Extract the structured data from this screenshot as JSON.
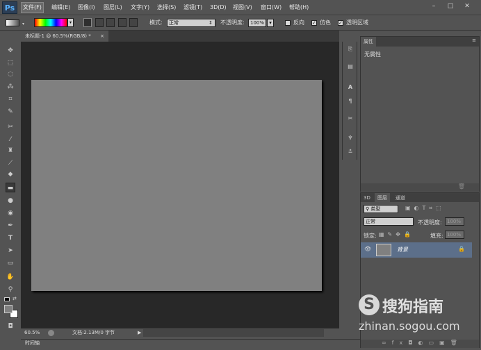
{
  "app": {
    "logo": "Ps"
  },
  "menubar": {
    "items": [
      "文件(F)",
      "编辑(E)",
      "图像(I)",
      "图层(L)",
      "文字(Y)",
      "选择(S)",
      "滤镜(T)",
      "3D(D)",
      "视图(V)",
      "窗口(W)",
      "帮助(H)"
    ],
    "active_index": 0
  },
  "window_controls": {
    "minimize": "–",
    "restore": "□",
    "close": "✕"
  },
  "options_bar": {
    "mode_label": "模式:",
    "mode_value": "正常",
    "opacity_label": "不透明度:",
    "opacity_value": "100%",
    "reverse_label": "反向",
    "dither_label": "仿色",
    "transparency_label": "透明区域",
    "dither_checked": true,
    "transparency_checked": true,
    "reverse_checked": false
  },
  "document": {
    "tab_title": "未标题-1 @ 60.5%(RGB/8) *",
    "close_glyph": "×",
    "canvas_color": "#808080"
  },
  "status_bar": {
    "zoom": "60.5%",
    "doc_info": "文档:2.13M/0 字节",
    "arrow": "▶"
  },
  "timeline": {
    "label": "时间轴"
  },
  "properties_panel": {
    "tab_label": "属性",
    "content": "无属性"
  },
  "layers_panel": {
    "tabs": [
      "3D",
      "图层",
      "通道"
    ],
    "active_tab_index": 1,
    "filter_label": "类型",
    "blend_mode": "正常",
    "opacity_label": "不透明度:",
    "opacity_value": "100%",
    "lock_label": "锁定:",
    "fill_label": "填充:",
    "fill_value": "100%",
    "layers": [
      {
        "name": "背景",
        "visible": true,
        "locked": true
      }
    ]
  },
  "watermark": {
    "brand": "搜狗指南",
    "url": "zhinan.sogou.com"
  },
  "colors": {
    "accent_selection": "#5c6f8a",
    "ps_blue": "#5bb4ff"
  },
  "tool_icons": [
    "move-icon",
    "marquee-icon",
    "lasso-icon",
    "magic-wand-icon",
    "crop-icon",
    "eyedropper-icon",
    "spot-healing-icon",
    "brush-icon",
    "clone-stamp-icon",
    "history-brush-icon",
    "eraser-icon",
    "gradient-icon",
    "blur-icon",
    "dodge-icon",
    "pen-icon",
    "type-icon",
    "path-selection-icon",
    "shape-icon",
    "hand-icon",
    "zoom-icon"
  ]
}
